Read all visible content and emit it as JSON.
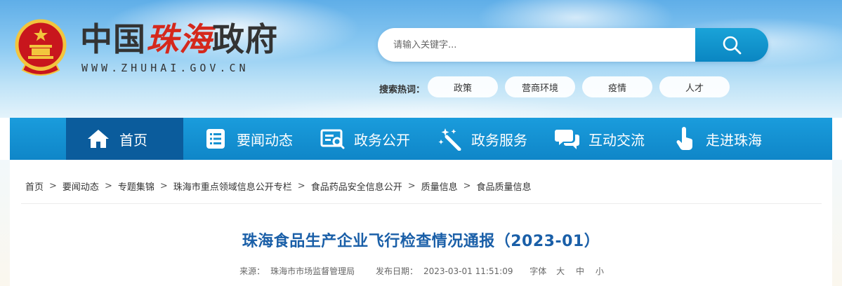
{
  "header": {
    "logo_text_1": "中国",
    "logo_text_accent": "珠海",
    "logo_text_2": "政府",
    "logo_url": "WWW.ZHUHAI.GOV.CN",
    "emblem_icon": "national-emblem-icon"
  },
  "search": {
    "placeholder": "请输入关键字...",
    "button_icon": "search-icon"
  },
  "hot_search": {
    "label": "搜索热词：",
    "tags": [
      "政策",
      "营商环境",
      "疫情",
      "人才"
    ]
  },
  "nav": {
    "items": [
      {
        "label": "首页",
        "icon": "home-icon"
      },
      {
        "label": "要闻动态",
        "icon": "list-icon"
      },
      {
        "label": "政务公开",
        "icon": "document-search-icon"
      },
      {
        "label": "政务服务",
        "icon": "wand-icon"
      },
      {
        "label": "互动交流",
        "icon": "chat-icon"
      },
      {
        "label": "走进珠海",
        "icon": "hand-pointer-icon"
      }
    ],
    "active_index": 0
  },
  "breadcrumb": [
    "首页",
    "要闻动态",
    "专题集锦",
    "珠海市重点领域信息公开专栏",
    "食品药品安全信息公开",
    "质量信息",
    "食品质量信息"
  ],
  "breadcrumb_separator": ">",
  "article": {
    "title": "珠海食品生产企业飞行检查情况通报（2023-01）",
    "source_label": "来源：",
    "source_value": "珠海市市场监督管理局",
    "date_label": "发布日期：",
    "date_value": "2023-03-01 11:51:09",
    "font_label": "字体",
    "font_large": "大",
    "font_medium": "中",
    "font_small": "小"
  },
  "colors": {
    "nav_bg": "#1a9cdc",
    "nav_active": "#0b5c9c",
    "title": "#1a5fa8",
    "logo_accent": "#d5281c"
  }
}
